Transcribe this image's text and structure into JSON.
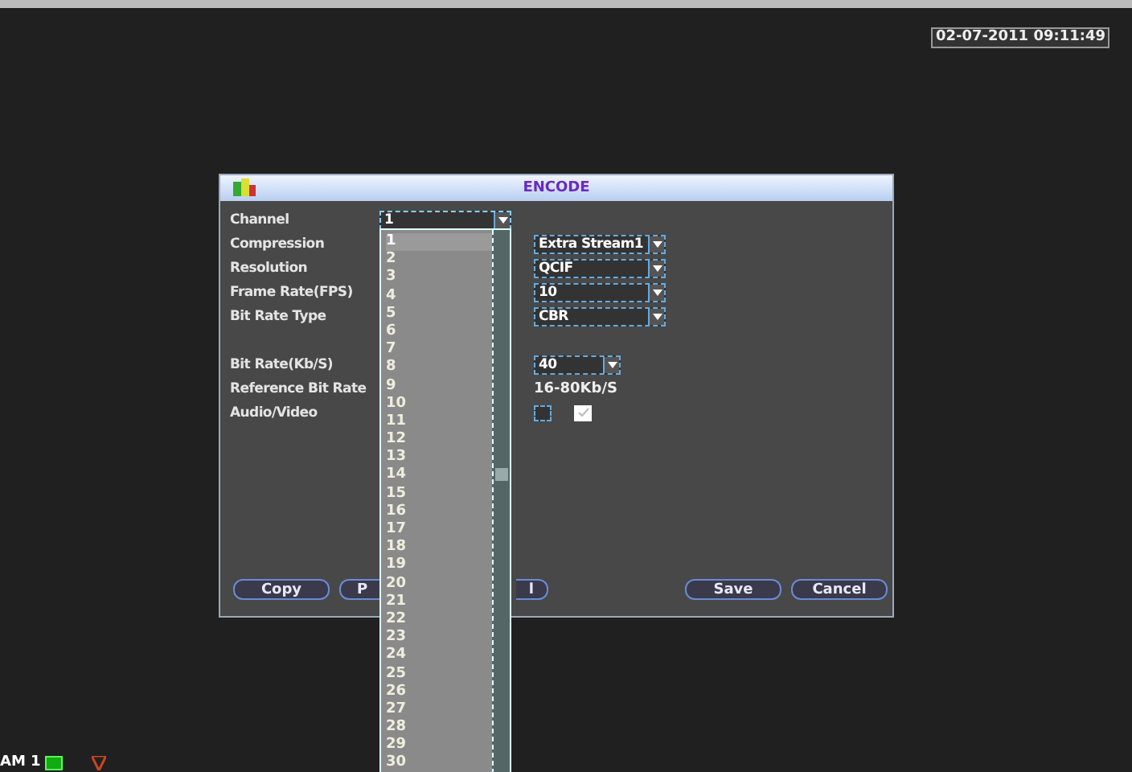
{
  "clock": "02-07-2011 09:11:49",
  "dialog": {
    "title": "ENCODE",
    "fields": [
      {
        "label": "Channel",
        "kind": "channel",
        "value": "1"
      },
      {
        "label": "Compression",
        "kind": "select",
        "value": "Extra Stream1"
      },
      {
        "label": "Resolution",
        "kind": "select",
        "value": "QCIF"
      },
      {
        "label": "Frame Rate(FPS)",
        "kind": "select",
        "value": "10"
      },
      {
        "label": "Bit Rate Type",
        "kind": "select",
        "value": "CBR"
      },
      {
        "kind": "blank"
      },
      {
        "label": "Bit Rate(Kb/S)",
        "kind": "short-select",
        "value": "40"
      },
      {
        "label": "Reference Bit Rate",
        "kind": "text",
        "value": "16-80Kb/S"
      },
      {
        "label": "Audio/Video",
        "kind": "checks",
        "checks": [
          {
            "checked": false
          },
          {
            "checked": true
          }
        ]
      }
    ],
    "buttons": [
      {
        "label": "Copy",
        "kind": "full"
      },
      {
        "label": "P",
        "kind": "left-part"
      },
      {
        "label": "l",
        "kind": "right-part"
      },
      {
        "kind": "gap"
      },
      {
        "label": "Save",
        "kind": "full"
      },
      {
        "label": "Cancel",
        "kind": "full"
      }
    ]
  },
  "channel_list": [
    {
      "label": "1",
      "selected": true
    },
    {
      "label": "2",
      "selected": false
    },
    {
      "label": "3",
      "selected": false
    },
    {
      "label": "4",
      "selected": false
    },
    {
      "label": "5",
      "selected": false
    },
    {
      "label": "6",
      "selected": false
    },
    {
      "label": "7",
      "selected": false
    },
    {
      "label": "8",
      "selected": false
    },
    {
      "label": "9",
      "selected": false
    },
    {
      "label": "10",
      "selected": false
    },
    {
      "label": "11",
      "selected": false
    },
    {
      "label": "12",
      "selected": false
    },
    {
      "label": "13",
      "selected": false
    },
    {
      "label": "14",
      "selected": false
    },
    {
      "label": "15",
      "selected": false
    },
    {
      "label": "16",
      "selected": false
    },
    {
      "label": "17",
      "selected": false
    },
    {
      "label": "18",
      "selected": false
    },
    {
      "label": "19",
      "selected": false
    },
    {
      "label": "20",
      "selected": false
    },
    {
      "label": "21",
      "selected": false
    },
    {
      "label": "22",
      "selected": false
    },
    {
      "label": "23",
      "selected": false
    },
    {
      "label": "24",
      "selected": false
    },
    {
      "label": "25",
      "selected": false
    },
    {
      "label": "26",
      "selected": false
    },
    {
      "label": "27",
      "selected": false
    },
    {
      "label": "28",
      "selected": false
    },
    {
      "label": "29",
      "selected": false
    },
    {
      "label": "30",
      "selected": false
    }
  ],
  "status": {
    "camera_label": "AM 1"
  }
}
